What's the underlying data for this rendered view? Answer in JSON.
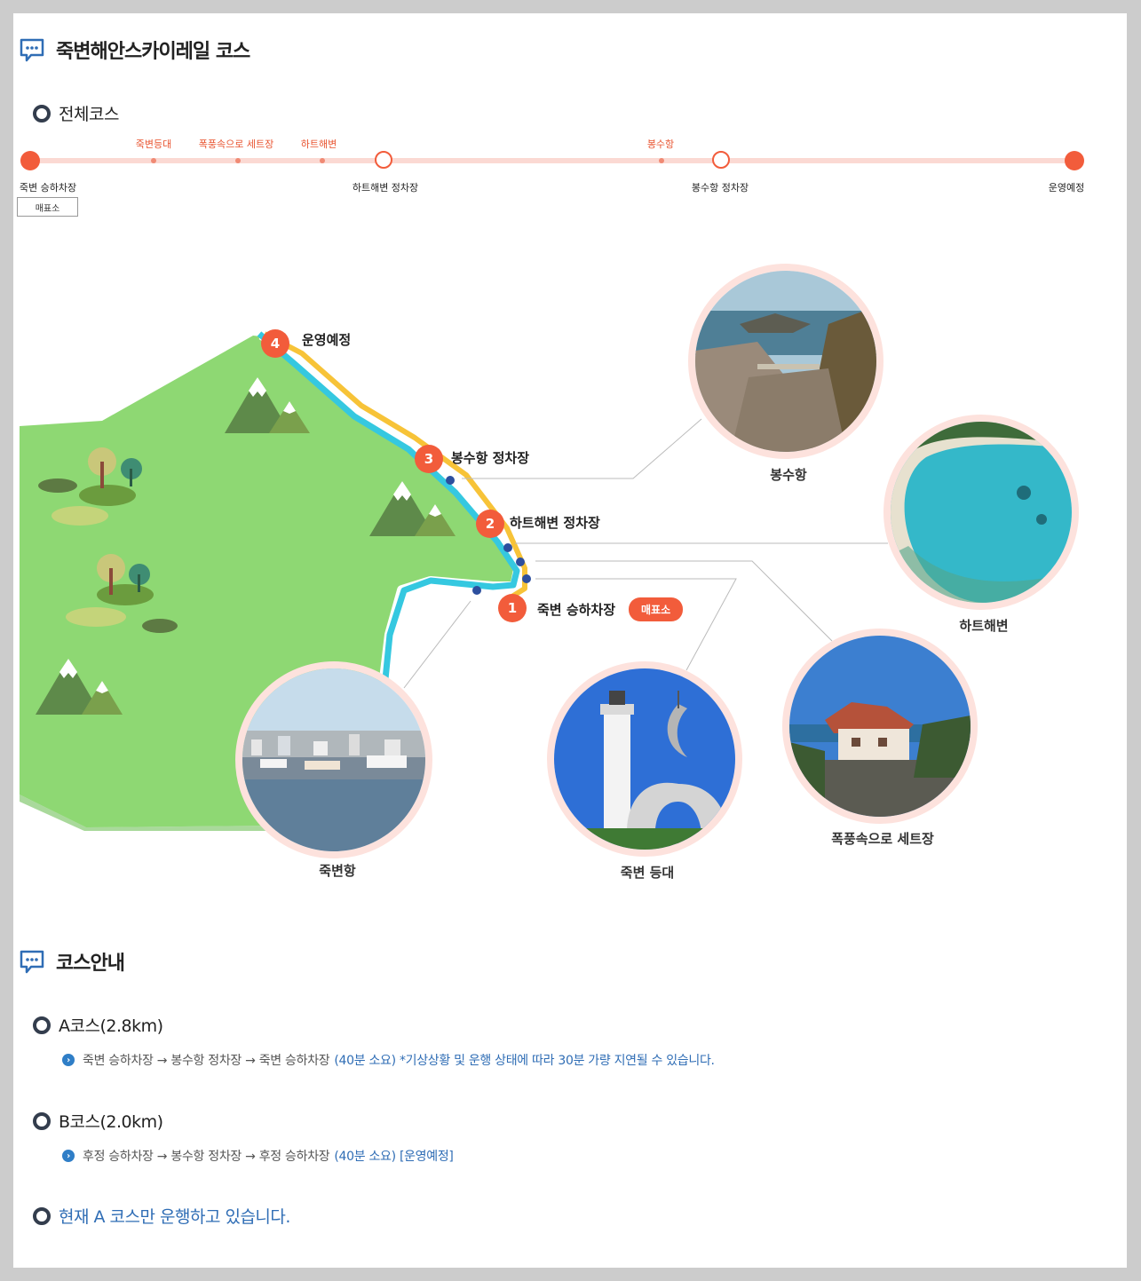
{
  "header": {
    "title": "죽변해안스카이레일 코스"
  },
  "overview": {
    "title": "전체코스",
    "top_labels": [
      "죽변등대",
      "폭풍속으로 세트장",
      "하트해변",
      "봉수항"
    ],
    "stations": [
      "죽변 승하차장",
      "하트해변 정차장",
      "봉수항 정차장",
      "운영예정"
    ],
    "ticket_label": "매표소"
  },
  "map": {
    "pins": [
      {
        "num": "1",
        "label": "죽변 승하차장"
      },
      {
        "num": "2",
        "label": "하트해변 정차장"
      },
      {
        "num": "3",
        "label": "봉수항 정차장"
      },
      {
        "num": "4",
        "label": "운영예정"
      }
    ],
    "ticket_badge": "매표소",
    "places": [
      "봉수항",
      "하트해변",
      "폭풍속으로 세트장",
      "죽변 등대",
      "죽변항"
    ]
  },
  "guide": {
    "title": "코스안내",
    "course_a": {
      "title": "A코스(2.8km)",
      "route": "죽변 승하차장 → 봉수항 정차장 → 죽변 승하차장",
      "note": "(40분 소요) *기상상황 및 운행 상태에 따라 30분 가량 지연될 수 있습니다."
    },
    "course_b": {
      "title": "B코스(2.0km)",
      "route": "후정 승하차장 → 봉수항 정차장 → 후정 승하차장",
      "note": "(40분 소요) [운영예정]"
    },
    "current": "현재 A 코스만 운행하고 있습니다."
  },
  "colors": {
    "accent": "#f25c3b",
    "link_blue": "#2f6db5",
    "land_green": "#8ed873",
    "rail_cyan": "#35c8e0",
    "rail_yellow": "#f7c338"
  }
}
